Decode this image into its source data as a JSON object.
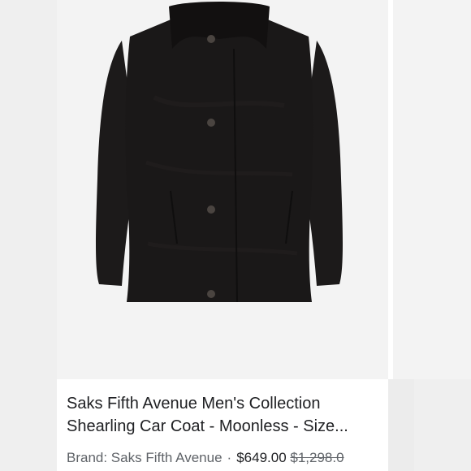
{
  "product": {
    "title_line1": "Saks Fifth Avenue Men's Collection",
    "title_line2": "Shearling Car Coat - Moonless - Size...",
    "brand": "Brand: Saks Fifth Avenue",
    "separator": "·",
    "price": "$649.00",
    "original_price": "$1,298.0",
    "image_alt": "black-shearling-car-coat"
  },
  "colors": {
    "coat": "#1a1818",
    "collar": "#121010",
    "buttons": "#4a4440",
    "background": "#f3f3f3"
  }
}
